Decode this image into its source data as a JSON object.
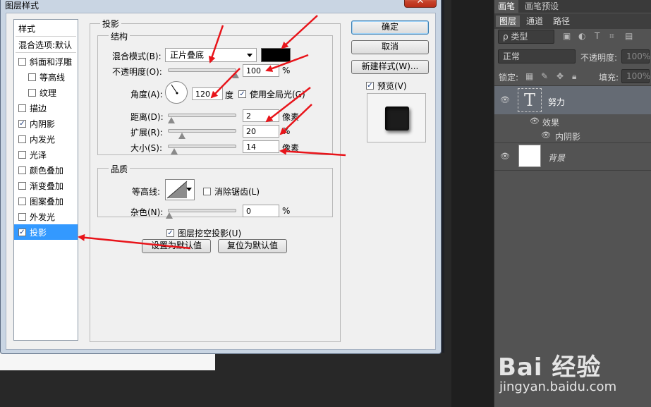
{
  "dialog": {
    "title": "图层样式",
    "close_label": "✕",
    "style_list": {
      "header": "样式",
      "blend_options": "混合选项:默认",
      "items": [
        {
          "label": "斜面和浮雕",
          "checked": false,
          "level": "top"
        },
        {
          "label": "等高线",
          "checked": false,
          "level": "sub"
        },
        {
          "label": "纹理",
          "checked": false,
          "level": "sub"
        },
        {
          "label": "描边",
          "checked": false,
          "level": "top"
        },
        {
          "label": "内阴影",
          "checked": true,
          "level": "top"
        },
        {
          "label": "内发光",
          "checked": false,
          "level": "top"
        },
        {
          "label": "光泽",
          "checked": false,
          "level": "top"
        },
        {
          "label": "颜色叠加",
          "checked": false,
          "level": "top"
        },
        {
          "label": "渐变叠加",
          "checked": false,
          "level": "top"
        },
        {
          "label": "图案叠加",
          "checked": false,
          "level": "top"
        },
        {
          "label": "外发光",
          "checked": false,
          "level": "top"
        },
        {
          "label": "投影",
          "checked": true,
          "level": "top",
          "selected": true
        }
      ]
    },
    "drop_shadow": {
      "section_title": "投影",
      "structure_title": "结构",
      "blend_mode_label": "混合模式(B):",
      "blend_mode_value": "正片叠底",
      "shadow_color": "#000000",
      "opacity_label": "不透明度(O):",
      "opacity_value": "100",
      "opacity_unit": "%",
      "angle_label": "角度(A):",
      "angle_value": "120",
      "angle_unit": "度",
      "use_global_light_label": "使用全局光(G)",
      "use_global_light": true,
      "distance_label": "距离(D):",
      "distance_value": "2",
      "distance_unit": "像素",
      "spread_label": "扩展(R):",
      "spread_value": "20",
      "spread_unit": "%",
      "size_label": "大小(S):",
      "size_value": "14",
      "size_unit": "像素",
      "quality_title": "品质",
      "contour_label": "等高线:",
      "anti_alias_label": "消除锯齿(L)",
      "anti_alias": false,
      "noise_label": "杂色(N):",
      "noise_value": "0",
      "noise_unit": "%",
      "knockout_label": "图层挖空投影(U)",
      "knockout": true,
      "make_default_label": "设置为默认值",
      "reset_default_label": "复位为默认值"
    },
    "buttons": {
      "ok": "确定",
      "cancel": "取消",
      "new_style": "新建样式(W)...",
      "preview_label": "预览(V)",
      "preview": true
    }
  },
  "layers_panel": {
    "top_tabs": [
      "画笔",
      "画笔预设"
    ],
    "tabs": [
      "图层",
      "通道",
      "路径"
    ],
    "filter_label": "ρ 类型",
    "blend_mode": "正常",
    "opacity_label": "不透明度:",
    "opacity_value": "100%",
    "lock_label": "锁定:",
    "fill_label": "填充:",
    "fill_value": "100%",
    "layers": [
      {
        "name": "努力",
        "thumb": "T",
        "selected": true,
        "effects_label": "效果",
        "effect": "内阴影"
      },
      {
        "name": "背景",
        "selected": false
      }
    ]
  },
  "watermark": {
    "brand": "Bai 经验",
    "url": "jingyan.baidu.com"
  },
  "colors": {
    "arrow_red": "#e8141a",
    "selection_blue": "#3399ff",
    "panel_bg": "#535353"
  }
}
